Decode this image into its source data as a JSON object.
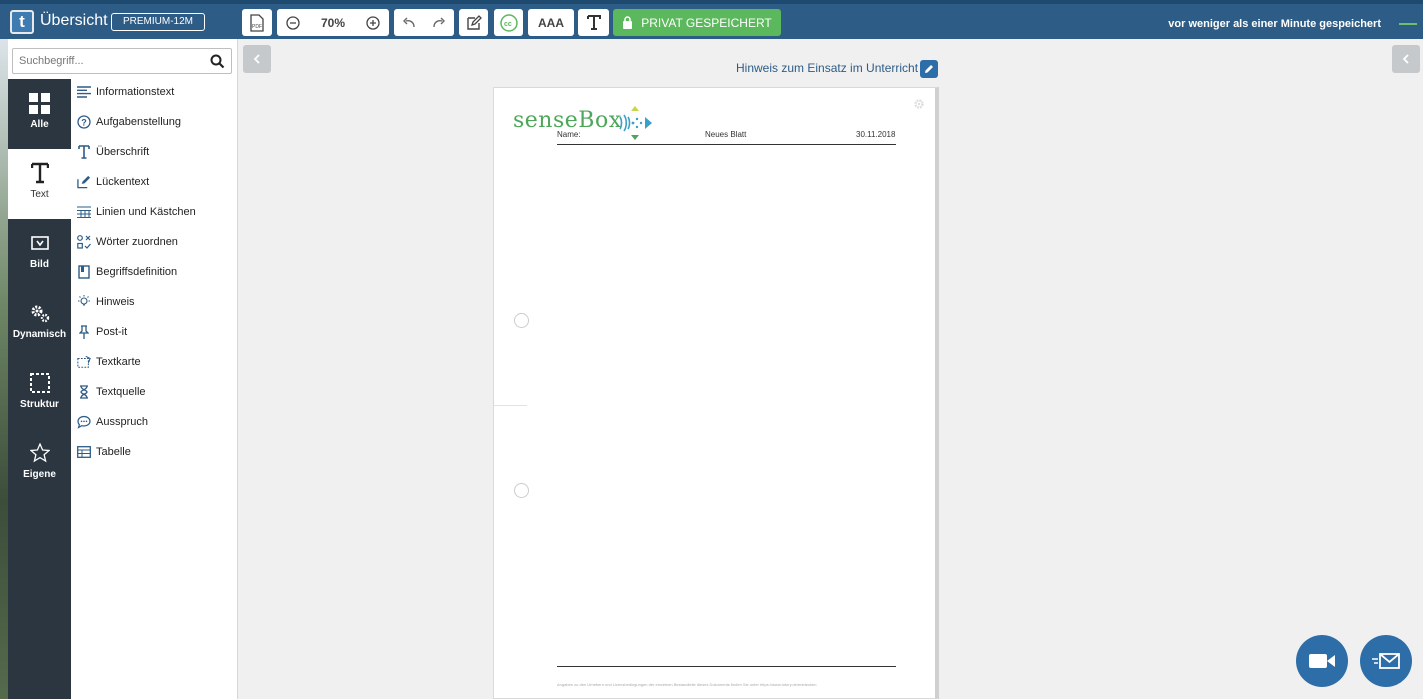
{
  "topbar": {
    "app_title": "Übersicht",
    "plan_badge": "PREMIUM-12M",
    "zoom_value": "70%",
    "font_size_label": "AAA",
    "saved_button": "PRIVAT GESPEICHERT",
    "save_status": "vor weniger als einer Minute gespeichert"
  },
  "sidebar": {
    "search_placeholder": "Suchbegriff...",
    "categories": [
      {
        "label": "Alle",
        "icon": "grid-icon"
      },
      {
        "label": "Text",
        "icon": "text-t-icon"
      },
      {
        "label": "Bild",
        "icon": "image-icon"
      },
      {
        "label": "Dynamisch",
        "icon": "gears-icon"
      },
      {
        "label": "Struktur",
        "icon": "dashed-square-icon"
      },
      {
        "label": "Eigene",
        "icon": "star-icon"
      }
    ],
    "items": [
      {
        "label": "Informationstext",
        "icon": "lines-icon"
      },
      {
        "label": "Aufgabenstellung",
        "icon": "question-circle-icon"
      },
      {
        "label": "Überschrift",
        "icon": "heading-t-icon"
      },
      {
        "label": "Lückentext",
        "icon": "pencil-square-icon"
      },
      {
        "label": "Linien und Kästchen",
        "icon": "ruled-grid-icon"
      },
      {
        "label": "Wörter zuordnen",
        "icon": "match-icon"
      },
      {
        "label": "Begriffsdefinition",
        "icon": "book-icon"
      },
      {
        "label": "Hinweis",
        "icon": "lightbulb-icon"
      },
      {
        "label": "Post-it",
        "icon": "pin-icon"
      },
      {
        "label": "Textkarte",
        "icon": "card-icon"
      },
      {
        "label": "Textquelle",
        "icon": "hourglass-icon"
      },
      {
        "label": "Ausspruch",
        "icon": "speech-bubble-icon"
      },
      {
        "label": "Tabelle",
        "icon": "table-icon"
      }
    ]
  },
  "document": {
    "hint_link": "Hinweis zum Einsatz im Unterricht",
    "brand": "senseBox",
    "name_label": "Name:",
    "sheet_title": "Neues Blatt",
    "date": "30.11.2018",
    "footer_text": "Angaben zu den Urhebern und Lizenzbedingungen der einzelnen Bestandteile dieses Dokuments finden Sie unter https://www.tutory.de/entdecken"
  },
  "colors": {
    "topbar": "#2d5c86",
    "sidebar_dark": "#2b3640",
    "saved_green": "#5cb85c",
    "brand_green": "#4ea65a",
    "fab_blue": "#2d6ea8"
  }
}
